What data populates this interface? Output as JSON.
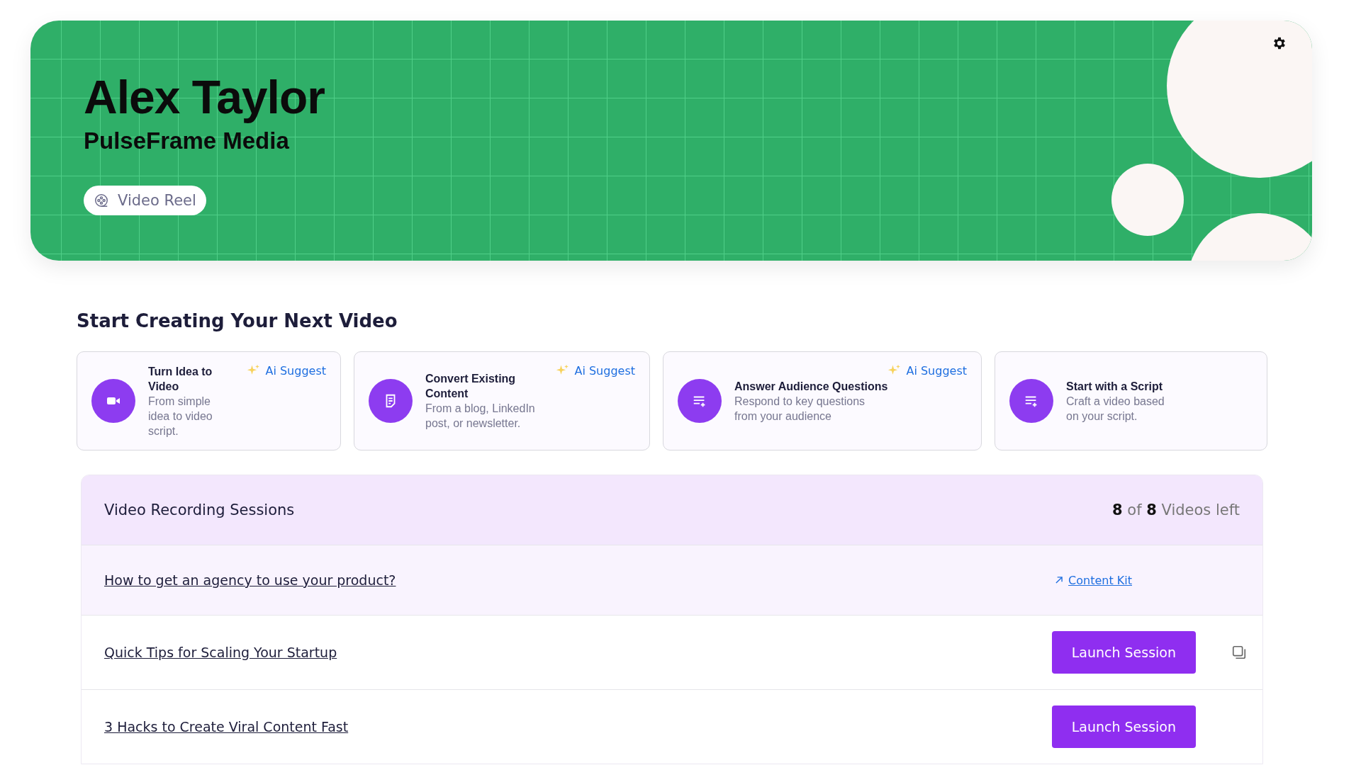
{
  "profile": {
    "name": "Alex Taylor",
    "company": "PulseFrame Media",
    "reel_button": "Video Reel"
  },
  "section_title": "Start Creating Your Next Video",
  "options": [
    {
      "kind": "camera",
      "title": "Turn Idea to Video",
      "description": "From simple idea to video script.",
      "ai_badge": "Ai Suggest"
    },
    {
      "kind": "document",
      "title": "Convert Existing Content",
      "description": "From a blog, LinkedIn post, or newsletter.",
      "ai_badge": "Ai Suggest"
    },
    {
      "kind": "list",
      "title": "Answer Audience Questions",
      "description": "Respond to key questions from your audience",
      "ai_badge": "Ai Suggest"
    },
    {
      "kind": "list",
      "title": "Start with a Script",
      "description": "Craft a video based on your script."
    }
  ],
  "sessions": {
    "title": "Video Recording Sessions",
    "count": "**8** of **8** Videos left",
    "rows": [
      {
        "kind": "link",
        "title": "How to get an agency to use your product?",
        "action": "Content Kit",
        "selected": true,
        "copyable": false
      },
      {
        "kind": "launch",
        "title": "Quick Tips for Scaling Your Startup",
        "action": "Launch Session",
        "selected": false,
        "copyable": true
      },
      {
        "kind": "launch",
        "title": "3 Hacks to Create Viral Content Fast",
        "action": "Launch Session",
        "selected": false,
        "copyable": false
      }
    ]
  }
}
